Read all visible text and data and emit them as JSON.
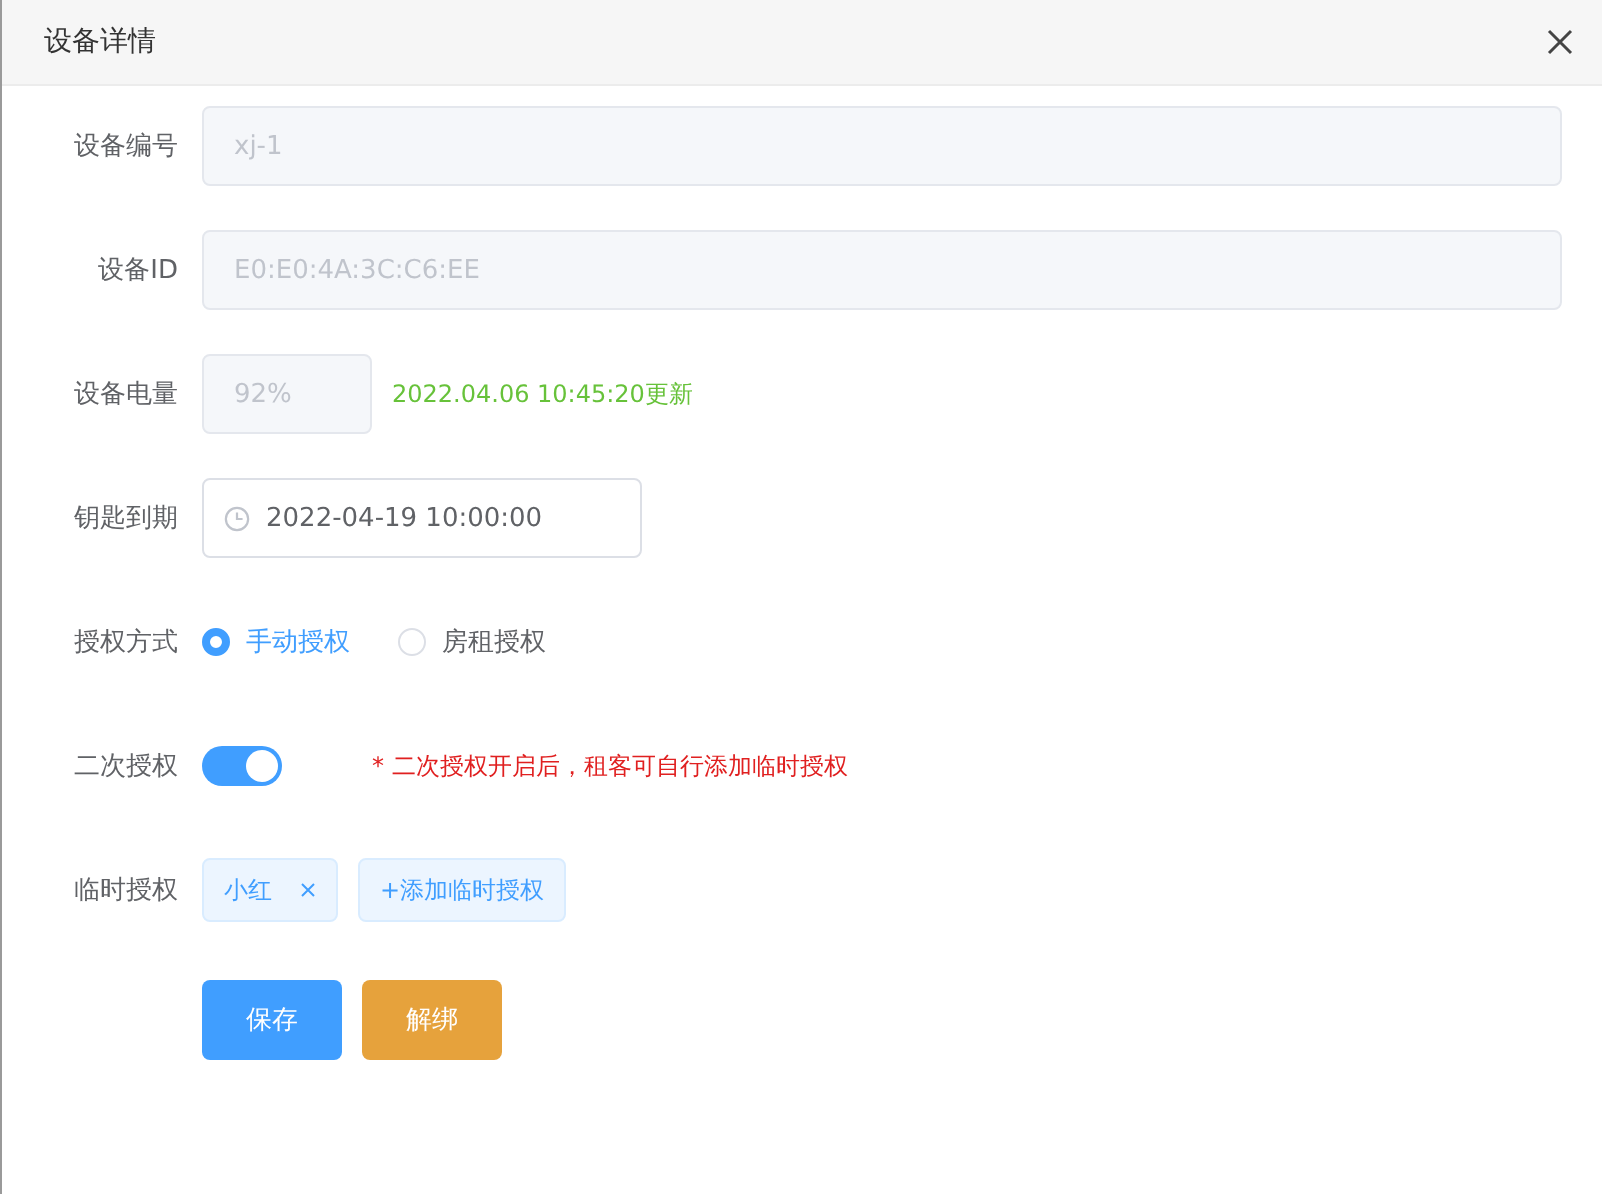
{
  "dialog": {
    "title": "设备详情"
  },
  "fields": [
    {
      "kind": "input",
      "label": "设备编号",
      "value": "xj-1",
      "disabled": true
    },
    {
      "kind": "input",
      "label": "设备ID",
      "value": "E0:E0:4A:3C:C6:EE",
      "disabled": true
    },
    {
      "kind": "battery",
      "label": "设备电量",
      "value": "92%",
      "disabled": true,
      "note": "2022.04.06 10:45:20更新"
    },
    {
      "kind": "datetime",
      "label": "钥匙到期",
      "value": "2022-04-19 10:00:00"
    },
    {
      "kind": "radio",
      "label": "授权方式",
      "options": [
        {
          "label": "手动授权",
          "selected": true
        },
        {
          "label": "房租授权",
          "selected": false
        }
      ]
    },
    {
      "kind": "switch",
      "label": "二次授权",
      "on": true,
      "hint": "* 二次授权开启后，租客可自行添加临时授权"
    },
    {
      "kind": "tags",
      "label": "临时授权",
      "tags": [
        "小红"
      ],
      "add": "+添加临时授权"
    }
  ],
  "buttons": [
    {
      "label": "保存",
      "kind": "primary"
    },
    {
      "label": "解绑",
      "kind": "warning"
    }
  ]
}
